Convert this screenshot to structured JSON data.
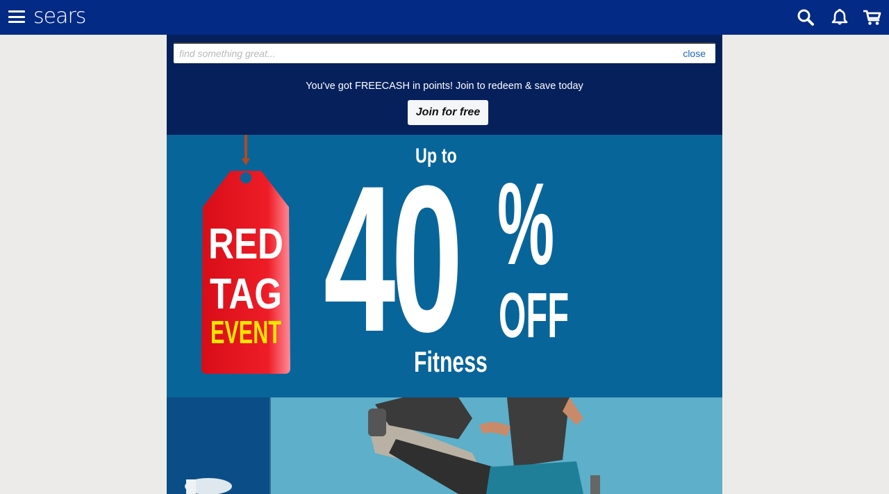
{
  "header": {
    "logo_text": "sears",
    "icons": [
      "menu-icon",
      "search-icon",
      "bell-icon",
      "cart-icon"
    ],
    "brand_color": "#032a85"
  },
  "search": {
    "placeholder": "find something great...",
    "close_label": "close"
  },
  "promo": {
    "message": "You've got FREECASH in points! Join to redeem & save today",
    "join_label": "Join for free",
    "background": "#06205c"
  },
  "hero": {
    "tag_lines": [
      "RED",
      "TAG",
      "EVENT"
    ],
    "up_to": "Up to",
    "discount_number": "40",
    "percent_sign": "%",
    "off": "OFF",
    "category": "Fitness",
    "background": "#08659a",
    "tag_color": "#e8141e",
    "event_color": "#ffe600"
  }
}
